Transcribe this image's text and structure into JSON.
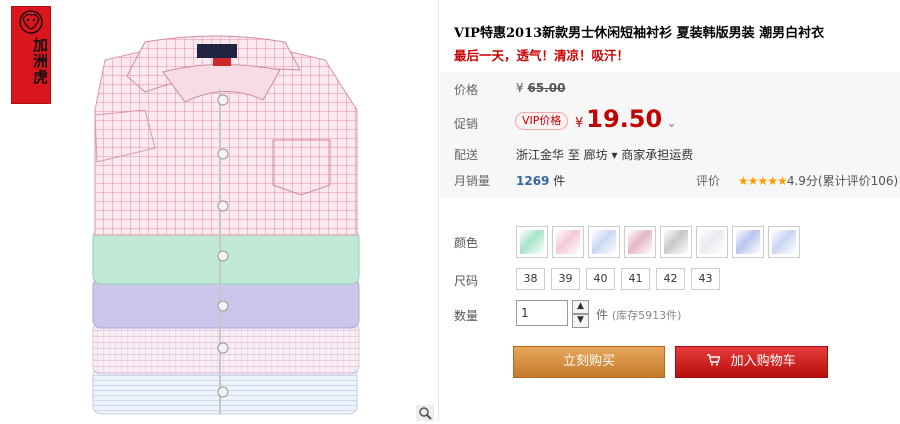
{
  "brand": {
    "seal_text": "加洲虎"
  },
  "product": {
    "title": "VIP特惠2013新款男士休闲短袖衬衫 夏装韩版男装 潮男白衬衣",
    "subtitle": "最后一天，透气！清凉！吸汗！"
  },
  "price": {
    "label": "价格",
    "currency": "¥",
    "original": "65.00"
  },
  "promo": {
    "label": "促销",
    "badge": "VIP价格",
    "currency": "¥",
    "value": "19.50",
    "caret": "⌄"
  },
  "delivery": {
    "label": "配送",
    "text": "浙江金华  至  廊坊 ▾  商家承担运费"
  },
  "sales": {
    "label": "月销量",
    "count": "1269",
    "unit": "件"
  },
  "rating": {
    "label": "评价",
    "stars": "★★★★★",
    "score": "4.9分(累计评价106)"
  },
  "colors": {
    "label": "颜色",
    "swatches": [
      "#a8e3c9",
      "#f3c9d9",
      "#c8d8f2",
      "#e6b5c8",
      "#c8c8cc",
      "#e9e9ef",
      "#b8c4ee",
      "#c9d6f2"
    ]
  },
  "sizes": {
    "label": "尺码",
    "options": [
      "38",
      "39",
      "40",
      "41",
      "42",
      "43"
    ]
  },
  "quantity": {
    "label": "数量",
    "value": "1",
    "unit": "件",
    "stock": "(库存5913件)"
  },
  "buttons": {
    "buy_now": "立刻购买",
    "add_to_cart": "加入购物车"
  },
  "icons": {
    "zoom": "magnifier-icon",
    "up": "▲",
    "down": "▼",
    "cart": "cart-icon"
  }
}
